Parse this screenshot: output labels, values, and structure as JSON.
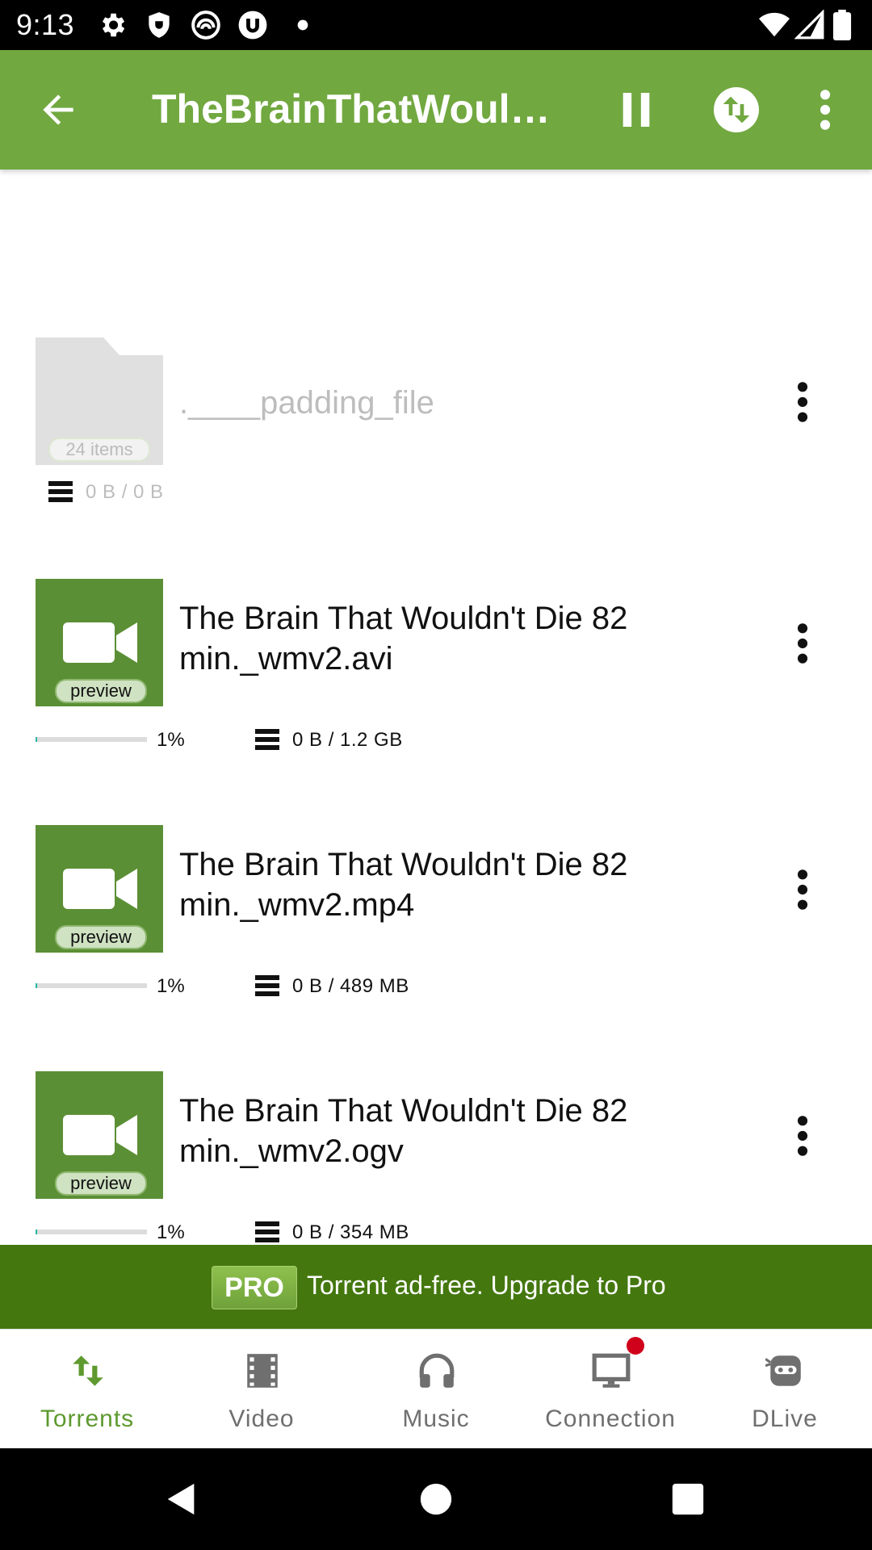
{
  "status_bar": {
    "time": "9:13",
    "left_icons": [
      "settings-icon",
      "shield-icon",
      "swirl-app-icon",
      "utorrent-icon",
      "dot-icon"
    ],
    "right_icons": [
      "wifi-icon",
      "cell-signal-icon",
      "battery-icon"
    ]
  },
  "app_bar": {
    "title": "TheBrainThatWoul…",
    "icons": [
      "back-arrow-icon",
      "pause-icon",
      "transfer-icon",
      "more-vert-icon"
    ],
    "color": "#71a840"
  },
  "files": [
    {
      "name": ".____padding_file",
      "thumb_type": "folder",
      "badge": "24 items",
      "storage": "0 B / 0 B",
      "progress": null,
      "dimmed": true
    },
    {
      "name": "The Brain That Wouldn't Die 82 min._wmv2.avi",
      "thumb_type": "video",
      "badge": "preview",
      "progress_pct": "1%",
      "progress": 0.01,
      "storage": "0 B / 1.2 GB"
    },
    {
      "name": "The Brain That Wouldn't Die 82 min._wmv2.mp4",
      "thumb_type": "video",
      "badge": "preview",
      "progress_pct": "1%",
      "progress": 0.01,
      "storage": "0 B / 489 MB"
    },
    {
      "name": "The Brain That Wouldn't Die 82 min._wmv2.ogv",
      "thumb_type": "video",
      "badge": "preview",
      "progress_pct": "1%",
      "progress": 0.01,
      "storage": "0 B / 354 MB"
    }
  ],
  "promo": {
    "badge": "PRO",
    "text": "Torrent ad-free. Upgrade to Pro",
    "color": "#44780f"
  },
  "bottom_nav": {
    "items": [
      {
        "label": "Torrents",
        "icon": "transfer-arrows-icon",
        "active": true
      },
      {
        "label": "Video",
        "icon": "film-icon",
        "active": false
      },
      {
        "label": "Music",
        "icon": "headphones-icon",
        "active": false
      },
      {
        "label": "Connection",
        "icon": "monitor-icon",
        "active": false,
        "notification": true
      },
      {
        "label": "DLive",
        "icon": "dlive-icon",
        "active": false
      }
    ],
    "active_color": "#5e9a2f"
  },
  "system_nav": {
    "icons": [
      "back-triangle-icon",
      "home-circle-icon",
      "recents-square-icon"
    ]
  }
}
